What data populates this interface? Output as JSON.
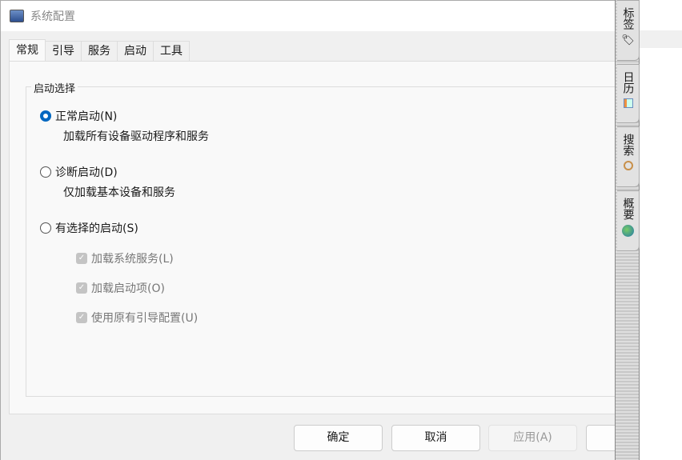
{
  "window": {
    "title": "系统配置"
  },
  "tabs": [
    "常规",
    "引导",
    "服务",
    "启动",
    "工具"
  ],
  "group": {
    "label": "启动选择",
    "options": [
      {
        "label": "正常启动(N)",
        "desc": "加载所有设备驱动程序和服务",
        "selected": true
      },
      {
        "label": "诊断启动(D)",
        "desc": "仅加载基本设备和服务",
        "selected": false
      },
      {
        "label": "有选择的启动(S)",
        "selected": false
      }
    ],
    "checks": [
      "加载系统服务(L)",
      "加载启动项(O)",
      "使用原有引导配置(U)"
    ]
  },
  "buttons": {
    "ok": "确定",
    "cancel": "取消",
    "apply": "应用(A)"
  },
  "side_tabs": [
    {
      "label": "标签",
      "icon": "tag-icon"
    },
    {
      "label": "日历",
      "icon": "calendar-icon"
    },
    {
      "label": "搜索",
      "icon": "search-icon"
    },
    {
      "label": "概要",
      "icon": "globe-icon"
    }
  ],
  "colors": {
    "accent": "#0067c0"
  }
}
